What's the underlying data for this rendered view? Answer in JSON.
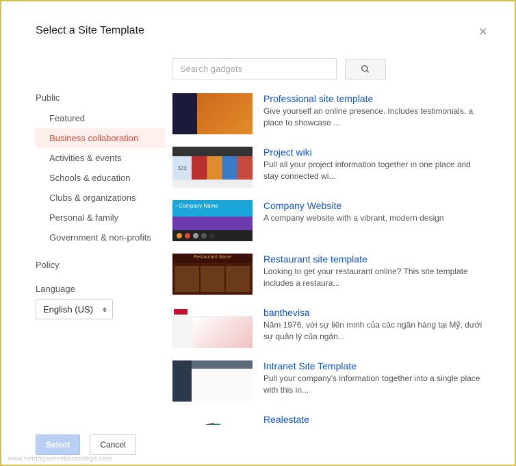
{
  "dialog": {
    "title": "Select a Site Template"
  },
  "search": {
    "placeholder": "Search gadgets"
  },
  "sidebar": {
    "publicLabel": "Public",
    "policyLabel": "Policy",
    "items": [
      "Featured",
      "Business collaboration",
      "Activities & events",
      "Schools & education",
      "Clubs & organizations",
      "Personal & family",
      "Government & non-profits"
    ],
    "selectedIndex": 1
  },
  "language": {
    "label": "Language",
    "selected": "English (US)"
  },
  "templates": [
    {
      "title": "Professional site template",
      "desc": "Give yourself an online presence. Includes testimonials, a place to showcase ..."
    },
    {
      "title": "Project wiki",
      "desc": "Pull all your project information together in one place and stay connected wi..."
    },
    {
      "title": "Company Website",
      "desc": "A company website with a vibrant, modern design"
    },
    {
      "title": "Restaurant site template",
      "desc": "Looking to get your restaurant online? This site template includes a restaura..."
    },
    {
      "title": "banthevisa",
      "desc": "Năm 1976, với sự liên minh của các ngân hàng tại Mỹ, dưới sự quản lý của ngân..."
    },
    {
      "title": "Intranet Site Template",
      "desc": "Pull your company's information together into a single place with this in..."
    },
    {
      "title": "Realestate",
      "desc": ""
    }
  ],
  "thumbLabels": {
    "wikiNumber": "323",
    "companyName": "Company Name",
    "restaurantName": "Restaurant Name"
  },
  "buttons": {
    "select": "Select",
    "cancel": "Cancel"
  },
  "watermark": "www.heritagechristiancollege.com"
}
